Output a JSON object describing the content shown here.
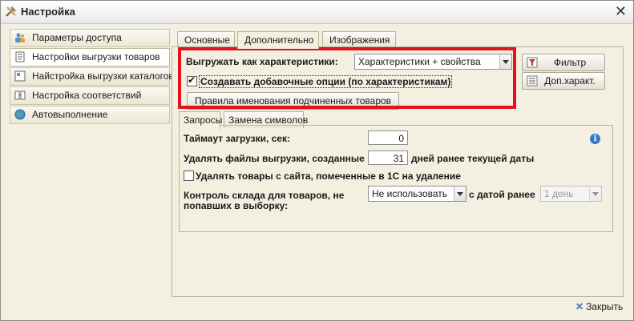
{
  "window": {
    "title": "Настройка",
    "close_symbol": "✕"
  },
  "sidebar": {
    "items": [
      {
        "label": "Параметры доступа",
        "icon": "users-icon"
      },
      {
        "label": "Настройки выгрузки товаров",
        "icon": "document-icon",
        "active": true
      },
      {
        "label": "Найстройка выгрузки каталогов",
        "icon": "catalog-icon"
      },
      {
        "label": "Настройка соответствий",
        "icon": "mapping-icon"
      },
      {
        "label": "Автовыполнение",
        "icon": "globe-icon"
      }
    ]
  },
  "main_tabs": [
    {
      "label": "Основные"
    },
    {
      "label": "Дополнительно",
      "active": true
    },
    {
      "label": "Изображения"
    }
  ],
  "export_as": {
    "label": "Выгружать как характеристики:",
    "value": "Характеристики + свойства"
  },
  "create_options": {
    "label": "Создавать добавочные опции (по характеристикам)",
    "checked": true
  },
  "naming_rules_button": "Правила именования подчиненных товаров",
  "filter_button": "Фильтр",
  "extra_char_button": "Доп.характ.",
  "sub_tabs": [
    {
      "label": "Запросы",
      "active": true
    },
    {
      "label": "Замена символов"
    }
  ],
  "timeout": {
    "label": "Таймаут загрузки, сек:",
    "value": "0"
  },
  "delete_files": {
    "label": "Удалять файлы выгрузки, созданные",
    "value": "31",
    "suffix": "дней ранее текущей даты"
  },
  "delete_products": {
    "label": "Удалять товары с сайта, помеченные в 1С на удаление",
    "checked": false
  },
  "stock_control": {
    "label_line1": "Контроль склада для товаров, не",
    "label_line2": "попавших в выборку:",
    "value": "Не использовать",
    "date_label": "с датой ранее",
    "date_value": "1 день"
  },
  "info_symbol": "i",
  "close_button": "Закрыть",
  "colors": {
    "highlight": "#e4121b",
    "info": "#2f7ad0"
  }
}
